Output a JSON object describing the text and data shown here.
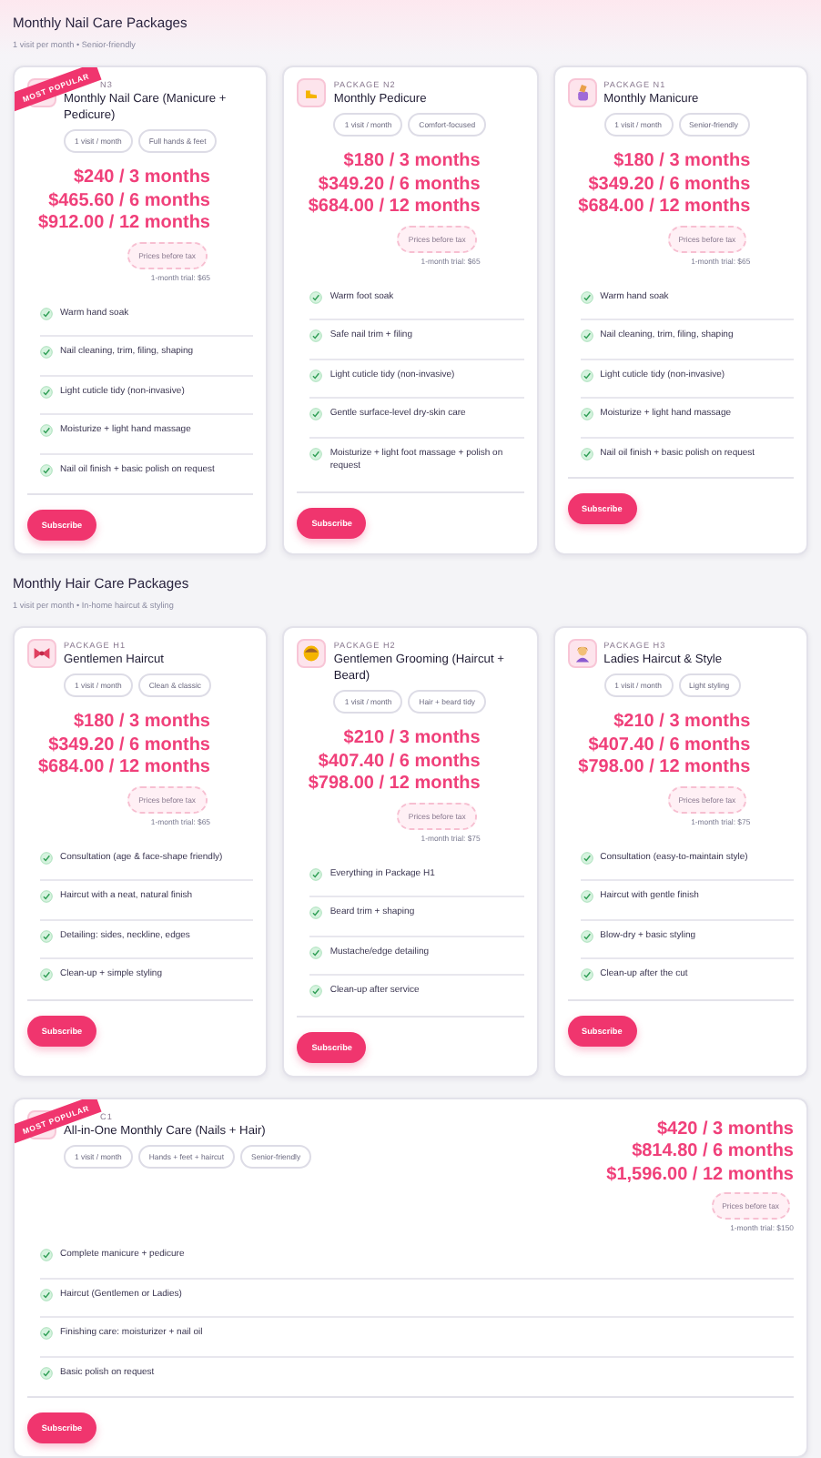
{
  "sections": [
    {
      "title": "Monthly Nail Care Packages",
      "subtitle": "1 visit per month • Senior-friendly",
      "packages": [
        {
          "badge": "MOST POPULAR",
          "label": "N3",
          "title": "Monthly Nail Care (Manicure + Pedicure)",
          "chips": [
            "1 visit / month",
            "Full hands & feet"
          ],
          "prices": [
            "$240 / 3 months",
            "$465.60 / 6 months",
            "$912.00 / 12 months"
          ],
          "tax_note": "Prices before tax",
          "trial": "1-month trial: $65",
          "features": [
            "Warm hand soak",
            "Nail cleaning, trim, filing, shaping",
            "Light cuticle tidy (non-invasive)",
            "Moisturize + light hand massage",
            "Nail oil finish + basic polish on request"
          ],
          "button": "Subscribe"
        },
        {
          "label": "PACKAGE N2",
          "title": "Monthly Pedicure",
          "chips": [
            "1 visit / month",
            "Comfort-focused"
          ],
          "prices": [
            "$180 / 3 months",
            "$349.20 / 6 months",
            "$684.00 / 12 months"
          ],
          "tax_note": "Prices before tax",
          "trial": "1-month trial: $65",
          "features": [
            "Warm foot soak",
            "Safe nail trim + filing",
            "Light cuticle tidy (non-invasive)",
            "Gentle surface-level dry-skin care",
            "Moisturize + light foot massage + polish on request"
          ],
          "button": "Subscribe"
        },
        {
          "label": "PACKAGE N1",
          "title": "Monthly Manicure",
          "chips": [
            "1 visit / month",
            "Senior-friendly"
          ],
          "prices": [
            "$180 / 3 months",
            "$349.20 / 6 months",
            "$684.00 / 12 months"
          ],
          "tax_note": "Prices before tax",
          "trial": "1-month trial: $65",
          "features": [
            "Warm hand soak",
            "Nail cleaning, trim, filing, shaping",
            "Light cuticle tidy (non-invasive)",
            "Moisturize + light hand massage",
            "Nail oil finish + basic polish on request"
          ],
          "button": "Subscribe"
        }
      ]
    },
    {
      "title": "Monthly Hair Care Packages",
      "subtitle": "1 visit per month • In-home haircut & styling",
      "packages": [
        {
          "label": "PACKAGE H1",
          "title": "Gentlemen Haircut",
          "chips": [
            "1 visit / month",
            "Clean & classic"
          ],
          "prices": [
            "$180 / 3 months",
            "$349.20 / 6 months",
            "$684.00 / 12 months"
          ],
          "tax_note": "Prices before tax",
          "trial": "1-month trial: $65",
          "features": [
            "Consultation (age & face-shape friendly)",
            "Haircut with a neat, natural finish",
            "Detailing: sides, neckline, edges",
            "Clean-up + simple styling"
          ],
          "button": "Subscribe"
        },
        {
          "label": "PACKAGE H2",
          "title": "Gentlemen Grooming (Haircut + Beard)",
          "chips": [
            "1 visit / month",
            "Hair + beard tidy"
          ],
          "prices": [
            "$210 / 3 months",
            "$407.40 / 6 months",
            "$798.00 / 12 months"
          ],
          "tax_note": "Prices before tax",
          "trial": "1-month trial: $75",
          "features": [
            "Everything in Package H1",
            "Beard trim + shaping",
            "Mustache/edge detailing",
            "Clean-up after service"
          ],
          "button": "Subscribe"
        },
        {
          "label": "PACKAGE H3",
          "title": "Ladies Haircut & Style",
          "chips": [
            "1 visit / month",
            "Light styling"
          ],
          "prices": [
            "$210 / 3 months",
            "$407.40 / 6 months",
            "$798.00 / 12 months"
          ],
          "tax_note": "Prices before tax",
          "trial": "1-month trial: $75",
          "features": [
            "Consultation (easy-to-maintain style)",
            "Haircut with gentle finish",
            "Blow-dry + basic styling",
            "Clean-up after the cut"
          ],
          "button": "Subscribe"
        }
      ]
    }
  ],
  "combo_package": {
    "badge": "MOST POPULAR",
    "label": "C1",
    "title": "All-in-One Monthly Care (Nails + Hair)",
    "chips": [
      "1 visit / month",
      "Hands + feet + haircut",
      "Senior-friendly"
    ],
    "prices": [
      "$420 / 3 months",
      "$814.80 / 6 months",
      "$1,596.00 / 12 months"
    ],
    "tax_note": "Prices before tax",
    "trial": "1-month trial: $150",
    "features": [
      "Complete manicure + pedicure",
      "Haircut (Gentlemen or Ladies)",
      "Finishing care: moisturizer + nail oil",
      "Basic polish on request"
    ],
    "button": "Subscribe"
  }
}
